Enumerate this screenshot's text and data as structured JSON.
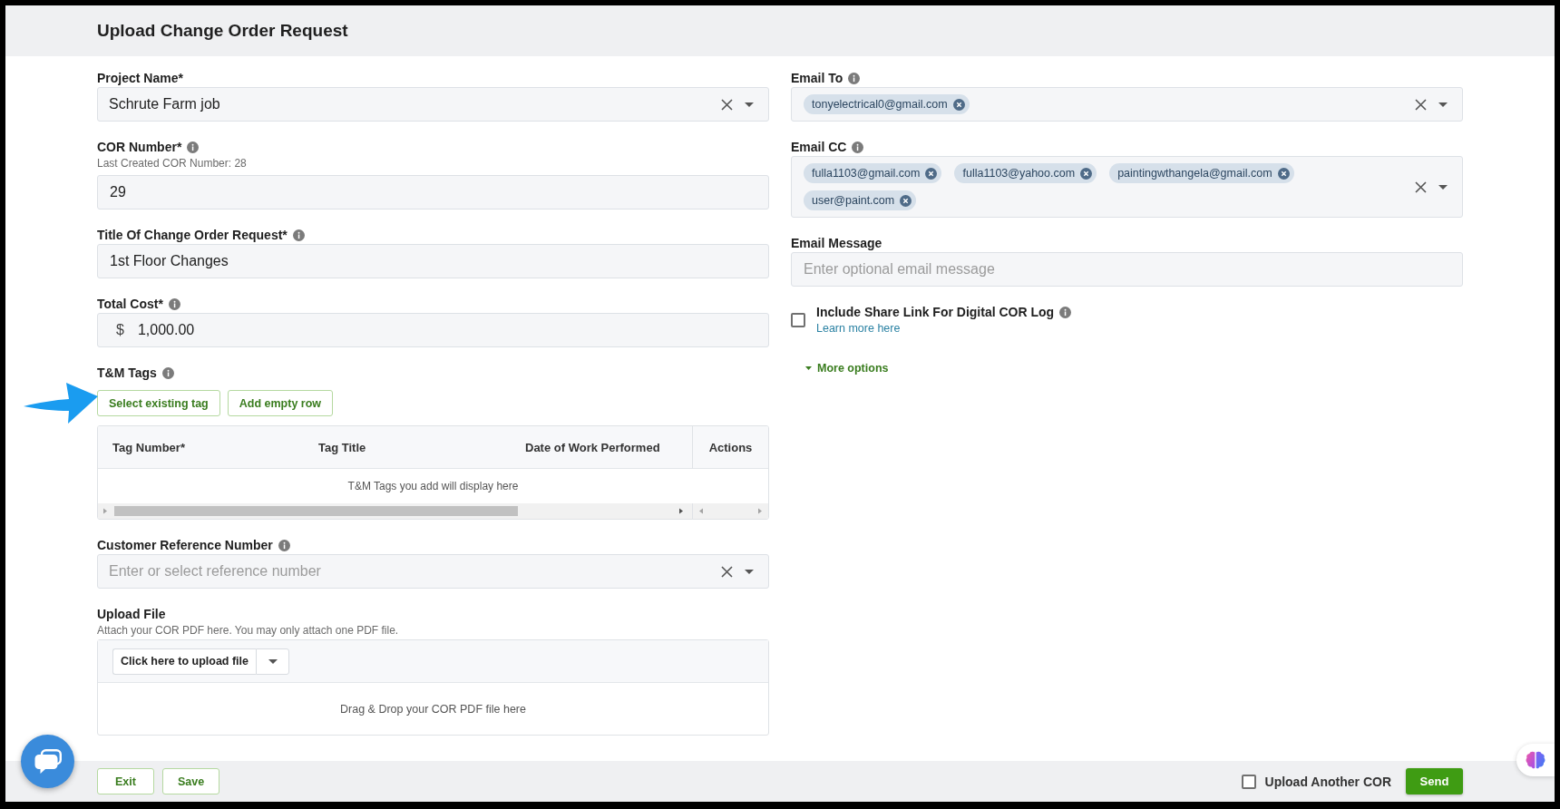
{
  "header": {
    "title": "Upload Change Order Request"
  },
  "project_name": {
    "label": "Project Name*",
    "value": "Schrute Farm job"
  },
  "cor_number": {
    "label": "COR Number*",
    "info": true,
    "hint": "Last Created COR Number: 28",
    "value": "29"
  },
  "cor_title": {
    "label": "Title Of Change Order Request*",
    "info": true,
    "value": "1st Floor Changes"
  },
  "total_cost": {
    "label": "Total Cost*",
    "info": true,
    "currency": "$",
    "value": "1,000.00"
  },
  "tm_tags": {
    "label": "T&M Tags",
    "info": true,
    "select_button": "Select existing tag",
    "add_button": "Add empty row",
    "table": {
      "columns": [
        "Tag Number*",
        "Tag Title",
        "Date of Work Performed",
        "Actions"
      ],
      "empty_message": "T&M Tags you add will display here"
    }
  },
  "customer_reference": {
    "label": "Customer Reference Number",
    "info": true,
    "placeholder": "Enter or select reference number"
  },
  "upload_file": {
    "label": "Upload File",
    "hint": "Attach your COR PDF here. You may only attach one PDF file.",
    "upload_button": "Click here to upload file",
    "drop_message": "Drag & Drop your COR PDF file here"
  },
  "email_to": {
    "label": "Email To",
    "info": true,
    "recipients": [
      "tonyelectrical0@gmail.com"
    ]
  },
  "email_cc": {
    "label": "Email CC",
    "info": true,
    "recipients": [
      "fulla1103@gmail.com",
      "fulla1103@yahoo.com",
      "paintingwthangela@gmail.com",
      "user@paint.com"
    ]
  },
  "email_message": {
    "label": "Email Message",
    "placeholder": "Enter optional email message"
  },
  "share_link": {
    "label": "Include Share Link For Digital COR Log",
    "info": true,
    "checked": false,
    "link": "Learn more here"
  },
  "more_options": {
    "label": "More options"
  },
  "footer": {
    "exit_button": "Exit",
    "save_button": "Save",
    "upload_another": {
      "label": "Upload Another COR",
      "checked": false
    },
    "send_button": "Send"
  }
}
